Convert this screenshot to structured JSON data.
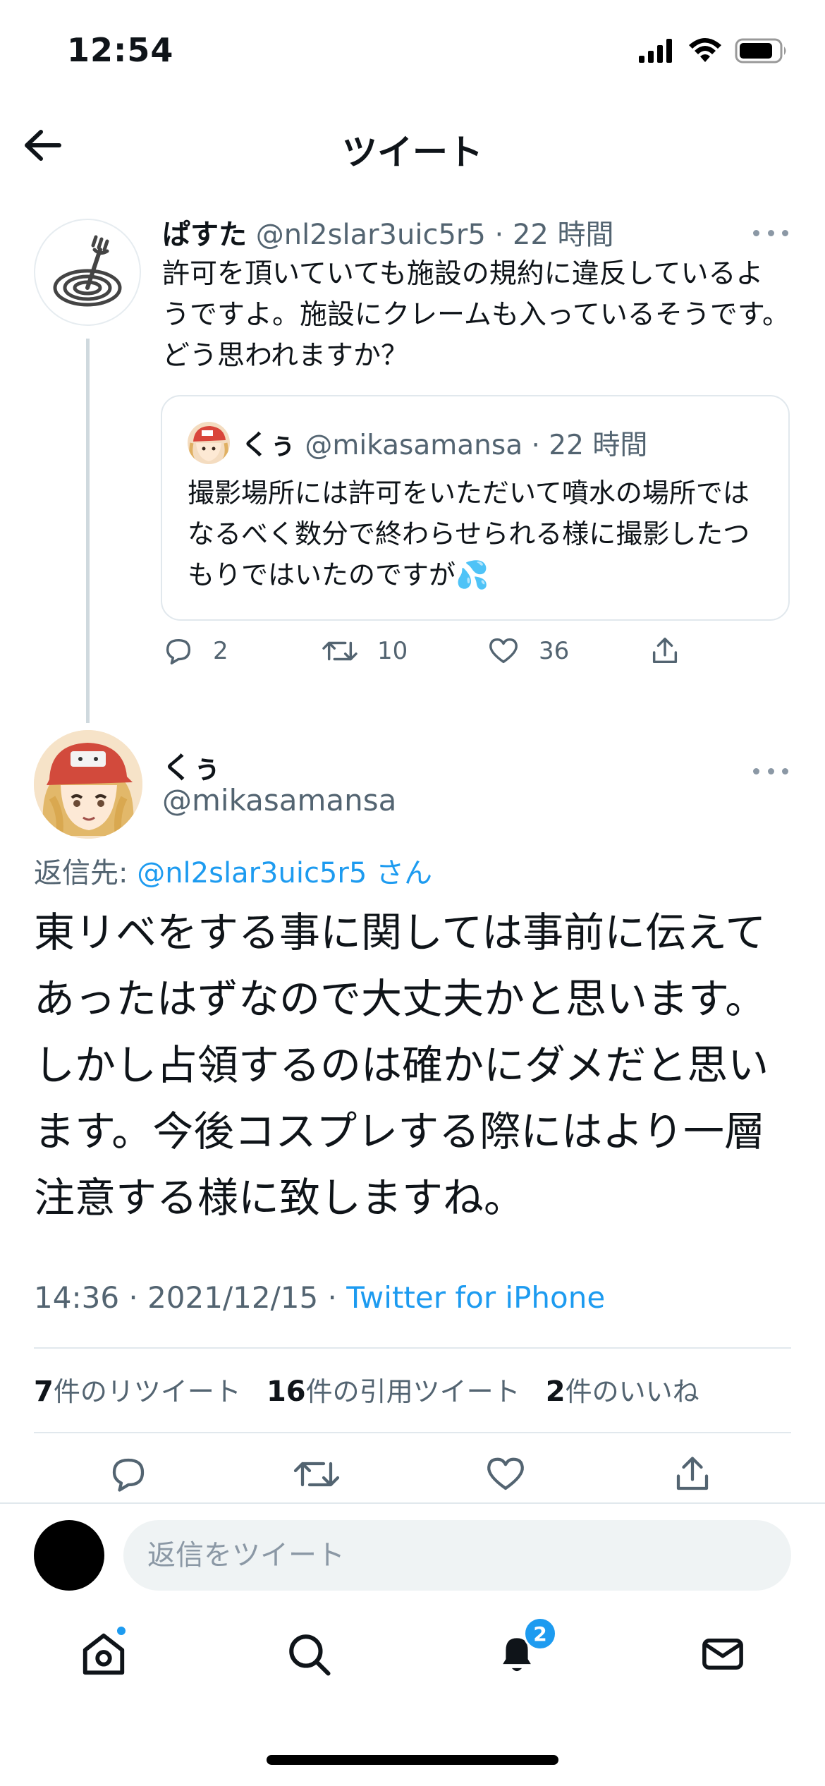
{
  "status_bar": {
    "time": "12:54"
  },
  "header": {
    "title": "ツイート"
  },
  "parent_tweet": {
    "name": "ぱすた",
    "handle": "@nl2slar3uic5r5",
    "time": "· 22 時間",
    "text": "許可を頂いていても施設の規約に違反しているようですよ。施設にクレームも入っているそうです。どう思われますか？",
    "quote": {
      "name": "くぅ",
      "handle": "@mikasamansa",
      "time": "· 22 時間",
      "text": "撮影場所には許可をいただいて噴水の場所ではなるべく数分で終わらせられる様に撮影したつもりではいたのですが💦"
    },
    "replies": "2",
    "retweets": "10",
    "likes": "36"
  },
  "main_tweet": {
    "name": "くぅ",
    "handle": "@mikasamansa",
    "reply_to_label": "返信先:",
    "reply_to_handle": "@nl2slar3uic5r5 さん",
    "text": "東リベをする事に関しては事前に伝えてあったはずなので大丈夫かと思います。しかし占領するのは確かにダメだと思います。今後コスプレする際にはより一層注意する様に致しますね。",
    "timestamp": "14:36 · 2021/12/15 · ",
    "source": "Twitter for iPhone",
    "retweet_count": "7",
    "retweet_label": "件のリツイート",
    "quote_count": "16",
    "quote_label": "件の引用ツイート",
    "like_count": "2",
    "like_label": "件のいいね"
  },
  "reply_bar": {
    "placeholder": "返信をツイート"
  },
  "tab_bar": {
    "items": [
      "home-icon",
      "search-icon",
      "notifications-icon",
      "messages-icon"
    ],
    "notification_count": "2"
  },
  "colors": {
    "accent": "#1d9bf0",
    "text": "#0f1419",
    "muted": "#536471"
  }
}
